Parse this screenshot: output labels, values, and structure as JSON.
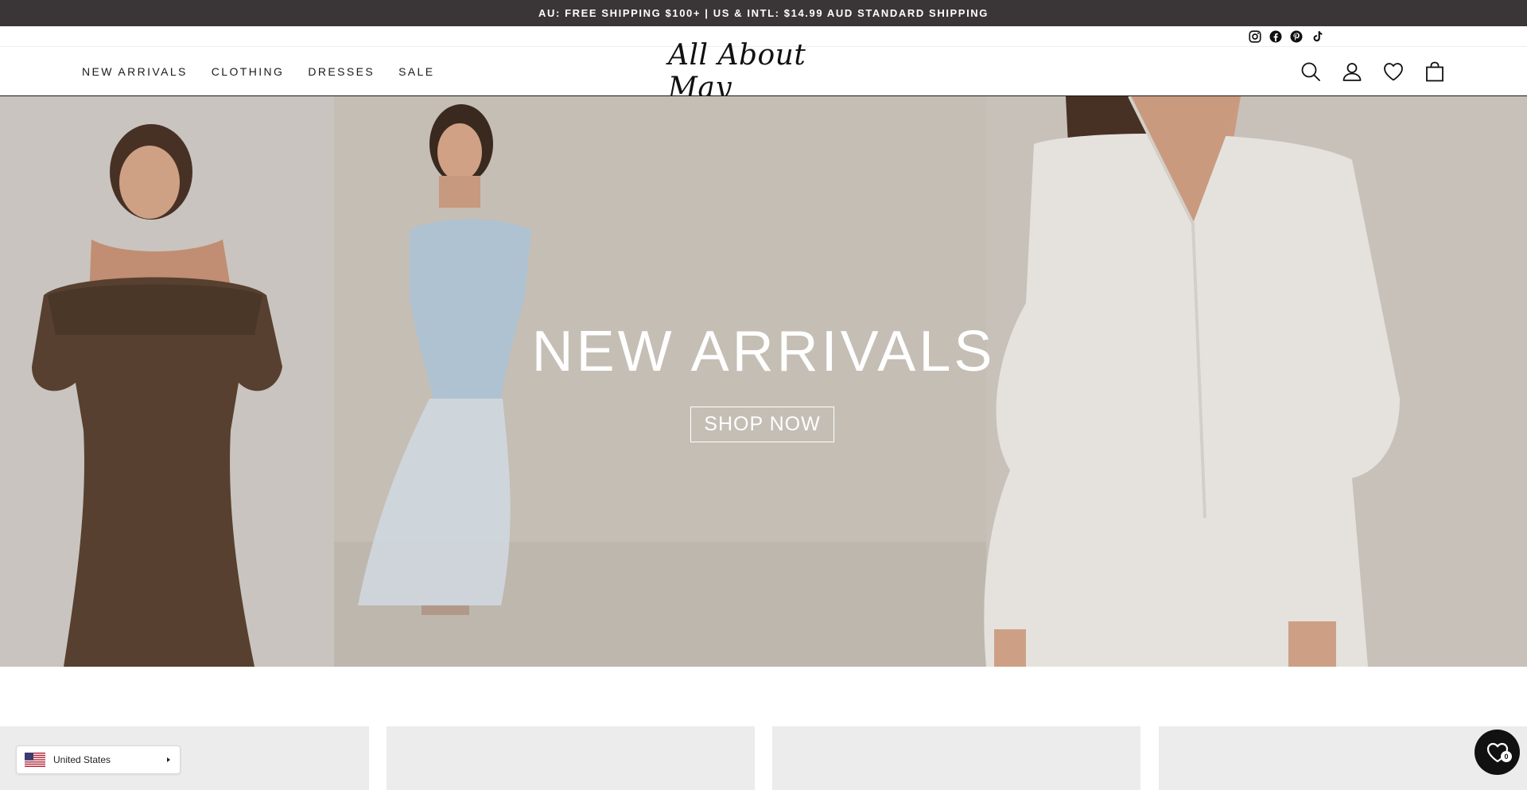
{
  "announcement": {
    "text": "AU: FREE SHIPPING $100+ | US & INTL: $14.99 AUD STANDARD SHIPPING"
  },
  "social": {
    "icons": [
      "instagram-icon",
      "facebook-icon",
      "pinterest-icon",
      "tiktok-icon"
    ]
  },
  "header": {
    "nav": [
      "NEW ARRIVALS",
      "CLOTHING",
      "DRESSES",
      "SALE"
    ],
    "logo": "All About May",
    "icons": [
      "search-icon",
      "account-icon",
      "wishlist-heart-icon",
      "cart-bag-icon"
    ]
  },
  "hero": {
    "title": "NEW ARRIVALS",
    "button": "SHOP NOW"
  },
  "country_selector": {
    "label": "United States",
    "flag": "us-flag-icon"
  },
  "wishlist_fab": {
    "count": "0"
  },
  "colors": {
    "announcement_bg": "#3a3536",
    "header_border": "#1a1a1a",
    "hero_text": "#ffffff",
    "tile_bg": "#ececec",
    "fab_bg": "#111111"
  }
}
